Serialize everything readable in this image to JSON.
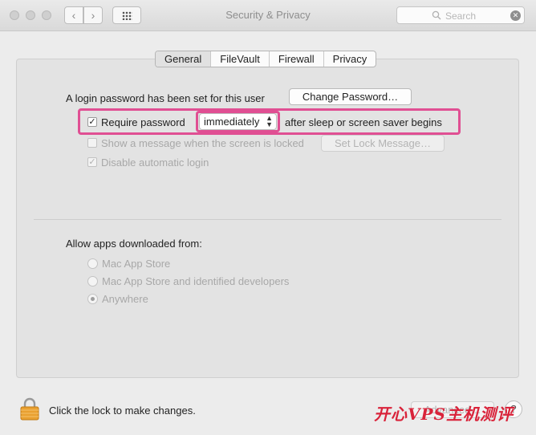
{
  "window": {
    "title": "Security & Privacy",
    "back_glyph": "‹",
    "forward_glyph": "›",
    "search_placeholder": "Search",
    "search_clear_glyph": "✕"
  },
  "tabs": [
    "General",
    "FileVault",
    "Firewall",
    "Privacy"
  ],
  "selected_tab": "General",
  "general": {
    "login_password_text": "A login password has been set for this user",
    "change_password_button": "Change Password…",
    "require_password": {
      "label": "Require password",
      "checked": true
    },
    "require_password_delay": "immediately",
    "require_password_suffix": "after sleep or screen saver begins",
    "show_message": {
      "label": "Show a message when the screen is locked",
      "checked": false
    },
    "set_lock_message_button": "Set Lock Message…",
    "disable_auto_login": {
      "label": "Disable automatic login",
      "checked": true
    },
    "check_glyph": "✓"
  },
  "allow_apps": {
    "heading": "Allow apps downloaded from:",
    "options": [
      {
        "label": "Mac App Store",
        "selected": false
      },
      {
        "label": "Mac App Store and identified developers",
        "selected": false
      },
      {
        "label": "Anywhere",
        "selected": true
      }
    ]
  },
  "footer": {
    "lock_text": "Click the lock to make changes.",
    "advanced_button": "Advanced…",
    "help_glyph": "?"
  },
  "watermark": "开心VPS主机测评",
  "colors": {
    "highlight": "#e04f93",
    "lock_body": "#e9a030",
    "watermark": "#d9233a"
  },
  "icons": [
    "search-icon",
    "clear-search-icon",
    "lock-icon",
    "grid-icon",
    "back-icon",
    "forward-icon"
  ]
}
